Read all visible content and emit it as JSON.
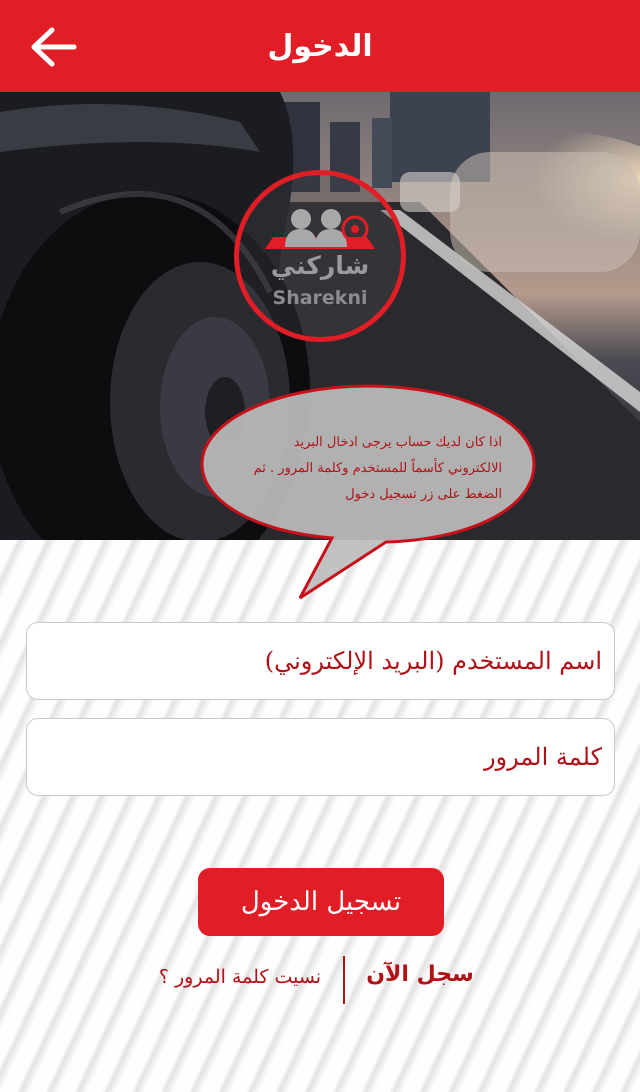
{
  "header": {
    "title": "الدخول",
    "back_icon": "arrow-left-icon",
    "background_color": "#e11d26"
  },
  "hero": {
    "logo_text_ar": "شاركني",
    "logo_text_en": "Sharekni",
    "logo_icon": "car-passengers-icon"
  },
  "hint": {
    "text": "اذا كان لديك حساب يرجى ادخال البريد الالكتروني كأسماً للمستخدم وكلمة المرور . ثم الضغط على زر تسجيل دخول"
  },
  "form": {
    "username_placeholder": "اسم المستخدم (البريد الإلكتروني)",
    "username_value": "",
    "password_placeholder": "كلمة المرور",
    "password_value": "",
    "login_label": "تسجيل الدخول"
  },
  "links": {
    "register_label": "سجل الآن",
    "forgot_label": "نسيت كلمة المرور ؟"
  },
  "colors": {
    "accent": "#e11d26",
    "text_accent": "#b01218"
  }
}
